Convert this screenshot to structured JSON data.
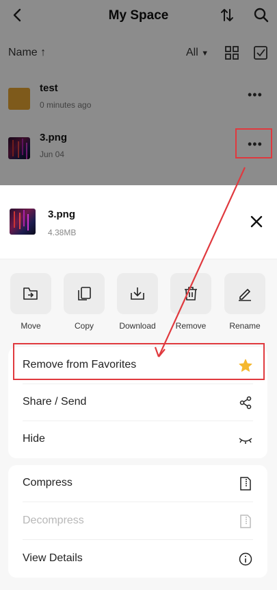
{
  "header": {
    "title": "My Space"
  },
  "filter": {
    "sort_label": "Name ↑",
    "view_filter": "All"
  },
  "files": [
    {
      "name": "test",
      "meta": "0 minutes ago",
      "icon": "folder-icon"
    },
    {
      "name": "3.png",
      "meta": "Jun 04",
      "icon": "image-thumbnail"
    }
  ],
  "sheet": {
    "file_name": "3.png",
    "file_size": "4.38MB",
    "actions": [
      {
        "label": "Move",
        "icon": "move-icon"
      },
      {
        "label": "Copy",
        "icon": "copy-icon"
      },
      {
        "label": "Download",
        "icon": "download-icon"
      },
      {
        "label": "Remove",
        "icon": "trash-icon"
      },
      {
        "label": "Rename",
        "icon": "edit-icon"
      }
    ],
    "menu_group1": [
      {
        "label": "Remove from Favorites",
        "icon": "star-icon"
      },
      {
        "label": "Share / Send",
        "icon": "share-icon"
      },
      {
        "label": "Hide",
        "icon": "hide-icon"
      }
    ],
    "menu_group2": [
      {
        "label": "Compress",
        "icon": "compress-icon"
      },
      {
        "label": "Decompress",
        "icon": "decompress-icon",
        "disabled": true
      },
      {
        "label": "View Details",
        "icon": "info-icon"
      }
    ]
  },
  "colors": {
    "highlight": "#e0393e",
    "star": "#f5b82e",
    "folder": "#e6a532"
  }
}
